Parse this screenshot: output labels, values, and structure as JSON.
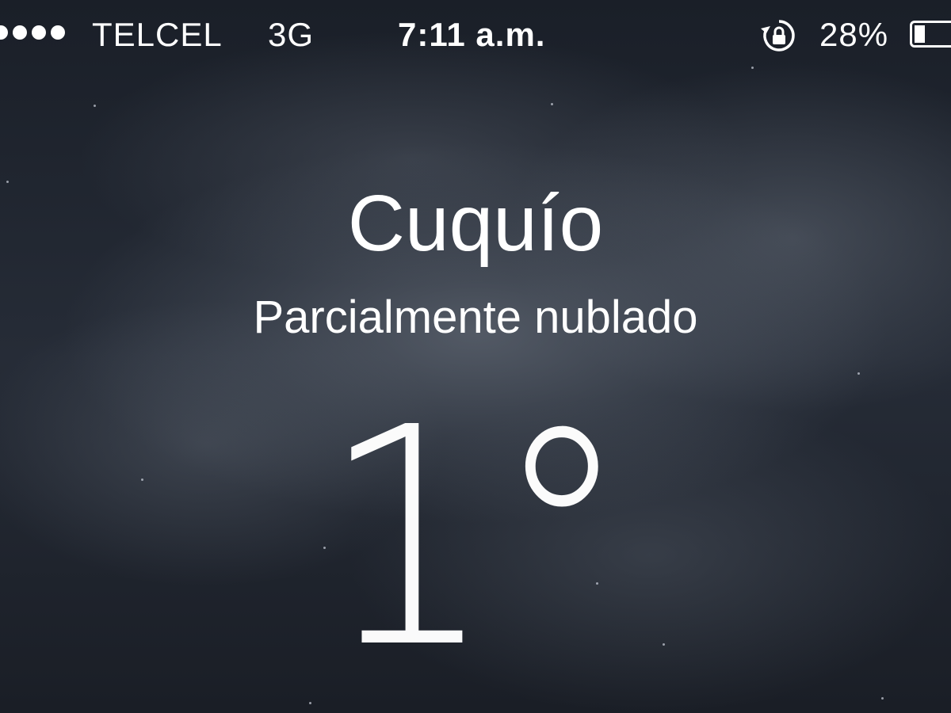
{
  "status_bar": {
    "signal_icon": "signal-dots-icon",
    "carrier": "TELCEL",
    "network": "3G",
    "time": "7:11 a.m.",
    "rotation_lock_icon": "rotation-lock-icon",
    "battery_percent": "28%",
    "battery_level": 0.28,
    "battery_icon": "battery-icon"
  },
  "weather": {
    "city": "Cuquío",
    "condition": "Parcialmente nublado",
    "temperature": "1°"
  },
  "colors": {
    "text": "#ffffff",
    "background": "#1b2029"
  }
}
